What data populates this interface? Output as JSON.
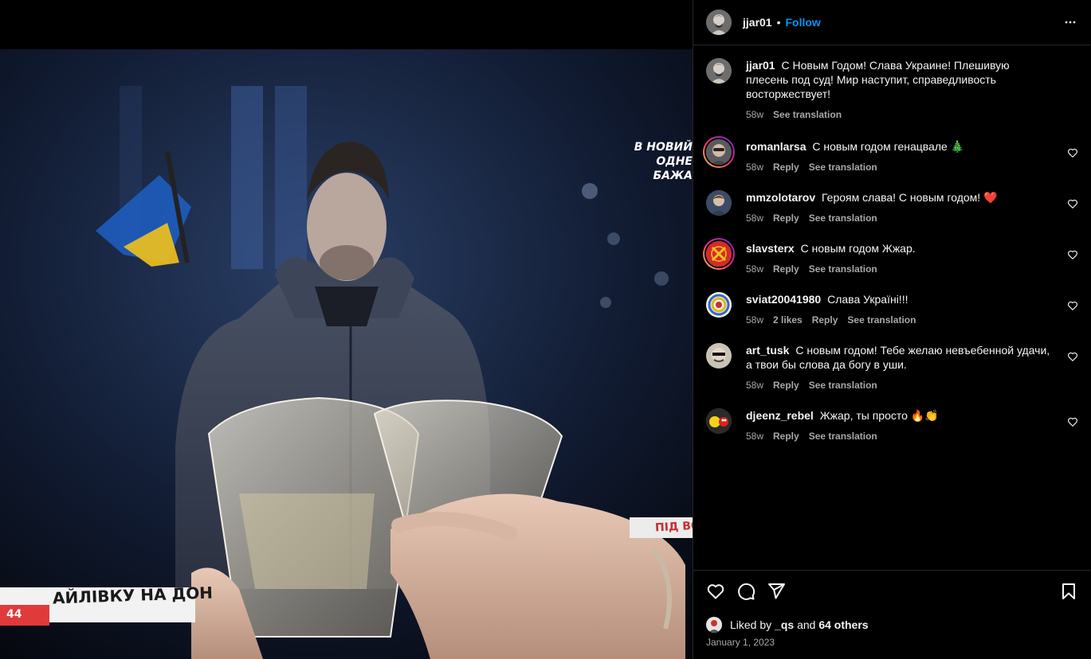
{
  "post": {
    "username": "jjar01",
    "dot": "•",
    "follow_label": "Follow",
    "more_icon": "more-horizontal-icon",
    "caption": {
      "username": "jjar01",
      "text": "С Новым Годом! Слава Украине! Плешивую плесень под суд! Мир наступит, справедливость восторжествует!",
      "time": "58w",
      "see_translation": "See translation"
    }
  },
  "media": {
    "tv_caption_top_1": "В НОВИЙ",
    "tv_caption_top_2": "ОДНЕ БАЖА",
    "tv_ticker": "АЙЛІВКУ НА ДОН",
    "tv_ticker_right": "ПІД ВО",
    "tv_channel": "44"
  },
  "comments": [
    {
      "username": "romanlarsa",
      "text": "С новым годом генацвале 🎄",
      "time": "58w",
      "likes": "",
      "reply": "Reply",
      "see_translation": "See translation"
    },
    {
      "username": "mmzolotarov",
      "text": "Героям слава! С новым годом! ❤️",
      "time": "58w",
      "likes": "",
      "reply": "Reply",
      "see_translation": "See translation"
    },
    {
      "username": "slavsterx",
      "text": "С новым годом Жжар.",
      "time": "58w",
      "likes": "",
      "reply": "Reply",
      "see_translation": "See translation"
    },
    {
      "username": "sviat20041980",
      "text": "Слава Україні!!!",
      "time": "58w",
      "likes": "2 likes",
      "reply": "Reply",
      "see_translation": "See translation"
    },
    {
      "username": "art_tusk",
      "text": "С новым годом! Тебе желаю невъебенной удачи, а твои бы слова да богу в уши.",
      "time": "58w",
      "likes": "",
      "reply": "Reply",
      "see_translation": "See translation"
    },
    {
      "username": "djeenz_rebel",
      "text": "Жжар, ты просто 🔥👏",
      "time": "58w",
      "likes": "",
      "reply": "Reply",
      "see_translation": "See translation"
    }
  ],
  "footer": {
    "liked_by_prefix": "Liked by",
    "liked_by_user": "_qs",
    "liked_by_and": "and",
    "liked_by_others": "64 others",
    "date": "January 1, 2023"
  },
  "colors": {
    "accent": "#0095f6",
    "background": "#000000",
    "muted_text": "#a8a8a8",
    "divider": "#262626"
  }
}
